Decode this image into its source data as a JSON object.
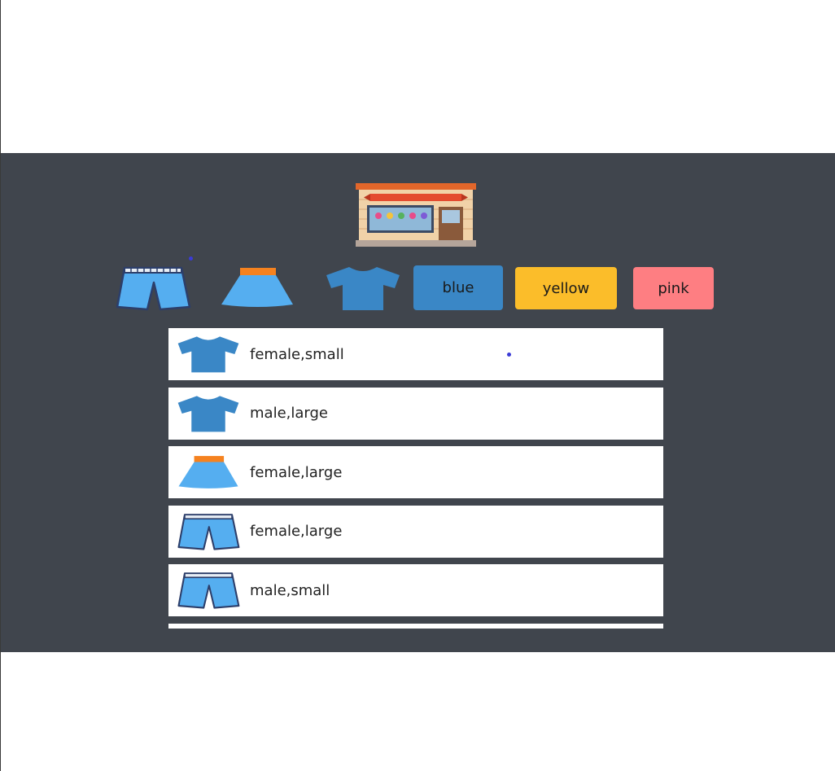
{
  "filters": {
    "categories": [
      {
        "id": "shorts",
        "icon": "shorts-icon"
      },
      {
        "id": "skirt",
        "icon": "skirt-icon"
      },
      {
        "id": "tshirt",
        "icon": "tshirt-icon"
      }
    ],
    "colors": [
      {
        "label": "blue",
        "color": "#3a87c6"
      },
      {
        "label": "yellow",
        "color": "#fbbd2a"
      },
      {
        "label": "pink",
        "color": "#fe7e82"
      }
    ]
  },
  "items": [
    {
      "icon": "tshirt-icon",
      "label": "female,small"
    },
    {
      "icon": "tshirt-icon",
      "label": "male,large"
    },
    {
      "icon": "skirt-icon",
      "label": "female,large"
    },
    {
      "icon": "shorts-icon",
      "label": "female,large"
    },
    {
      "icon": "shorts-icon",
      "label": "male,small"
    }
  ],
  "theme": {
    "background": "#40454d",
    "tshirt_color": "#3a87c6",
    "skirt_color": "#55aef0",
    "skirt_band": "#f5821f",
    "shorts_color": "#55aef0"
  }
}
